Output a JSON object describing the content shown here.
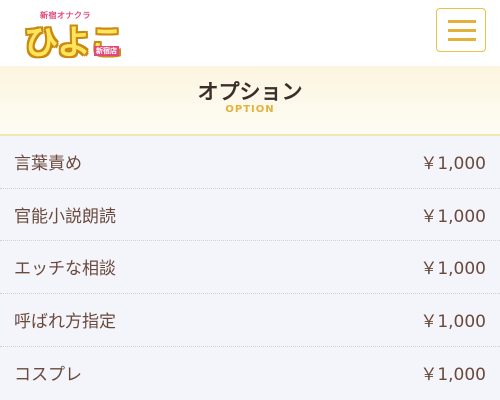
{
  "header": {
    "logo": {
      "small_text": "新宿オナクラ",
      "main_text": "ひよこ",
      "sub_text": "新宿店"
    },
    "menu_icon": "hamburger-menu-icon"
  },
  "section": {
    "title": "オプション",
    "subtitle": "OPTION"
  },
  "options": [
    {
      "name": "言葉責め",
      "price": "￥1,000"
    },
    {
      "name": "官能小説朗読",
      "price": "￥1,000"
    },
    {
      "name": "エッチな相談",
      "price": "￥1,000"
    },
    {
      "name": "呼ばれ方指定",
      "price": "￥1,000"
    },
    {
      "name": "コスプレ",
      "price": "￥1,000"
    }
  ],
  "colors": {
    "accent": "#e3b23c",
    "text": "#6a4a3e",
    "heading_text": "#3a2e2a",
    "background": "#f4f5fa"
  }
}
